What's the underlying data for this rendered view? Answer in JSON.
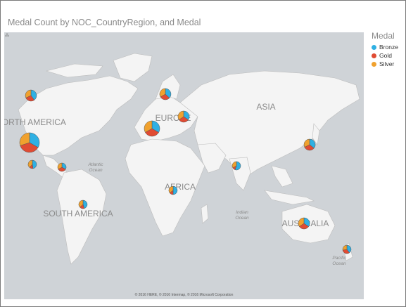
{
  "chart_data": {
    "type": "map-pie",
    "title": "Medal Count by NOC_CountryRegion, and Medal",
    "legend": {
      "title": "Medal",
      "placement": "right",
      "items": [
        {
          "name": "Bronze",
          "color": "#2fb0e3"
        },
        {
          "name": "Gold",
          "color": "#e04b33"
        },
        {
          "name": "Silver",
          "color": "#f0a12e"
        }
      ]
    },
    "region_labels": [
      "NORTH AMERICA",
      "EUROPE",
      "ASIA",
      "AFRICA",
      "SOUTH AMERICA",
      "AUSTRALIA"
    ],
    "ocean_labels": [
      "Atlantic Ocean",
      "Indian Ocean",
      "Pacific Ocean"
    ],
    "attribution": "© 2016 HERE, © 2016 Intermap, © 2016 Microsoft Corporation",
    "pies": [
      {
        "region": "north-america-usa",
        "size": "xl",
        "values": [
          1,
          1.1,
          0.9
        ]
      },
      {
        "region": "north-america-canada",
        "size": "m",
        "values": [
          1,
          0.7,
          0.8
        ]
      },
      {
        "region": "north-america-mexico",
        "size": "s",
        "values": [
          1,
          0.3,
          0.8
        ]
      },
      {
        "region": "caribbean",
        "size": "s",
        "values": [
          1,
          1,
          1
        ]
      },
      {
        "region": "europe-west",
        "size": "l",
        "values": [
          1,
          1,
          1
        ]
      },
      {
        "region": "europe-north",
        "size": "m",
        "values": [
          1,
          0.8,
          0.9
        ]
      },
      {
        "region": "europe-east",
        "size": "m",
        "values": [
          1,
          0.9,
          1
        ]
      },
      {
        "region": "asia-east",
        "size": "m",
        "values": [
          1,
          0.9,
          0.9
        ]
      },
      {
        "region": "asia-south",
        "size": "s",
        "values": [
          1,
          0.2,
          0.6
        ]
      },
      {
        "region": "africa",
        "size": "s",
        "values": [
          1,
          0.3,
          0.7
        ]
      },
      {
        "region": "south-america",
        "size": "s",
        "values": [
          1,
          0.4,
          0.8
        ]
      },
      {
        "region": "australia",
        "size": "m",
        "values": [
          1,
          0.9,
          1
        ]
      },
      {
        "region": "new-zealand",
        "size": "s",
        "values": [
          1,
          0.8,
          0.7
        ]
      }
    ]
  }
}
